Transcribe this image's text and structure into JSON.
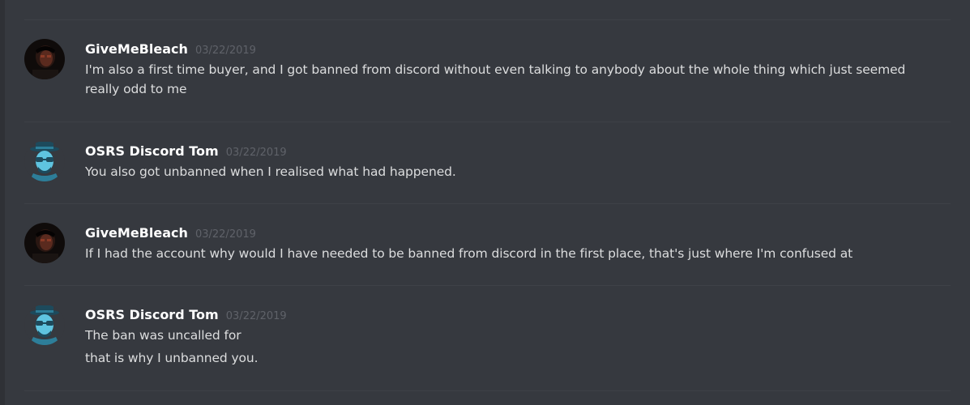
{
  "messages": [
    {
      "username": "GiveMeBleach",
      "avatar_icon": "photo-avatar-icon",
      "timestamp": "03/22/2019",
      "lines": [
        "I'm also a first time buyer, and I got banned from discord without even talking to anybody about the whole thing which just seemed",
        "really odd to me"
      ]
    },
    {
      "username": "OSRS Discord Tom",
      "avatar_icon": "heisenberg-avatar-icon",
      "timestamp": "03/22/2019",
      "lines": [
        "You also got unbanned when I realised what had happened."
      ]
    },
    {
      "username": "GiveMeBleach",
      "avatar_icon": "photo-avatar-icon",
      "timestamp": "03/22/2019",
      "lines": [
        "If I had the account why would I have needed to be banned from discord in the first place, that's just where I'm confused at"
      ]
    },
    {
      "username": "OSRS Discord Tom",
      "avatar_icon": "heisenberg-avatar-icon",
      "timestamp": "03/22/2019",
      "lines": [
        "The ban was uncalled for",
        "that is why I unbanned you."
      ]
    }
  ],
  "colors": {
    "background": "#36393f",
    "username": "#ffffff",
    "timestamp": "#5f6269",
    "message_text": "#dcddde",
    "divider": "#3e4147"
  }
}
